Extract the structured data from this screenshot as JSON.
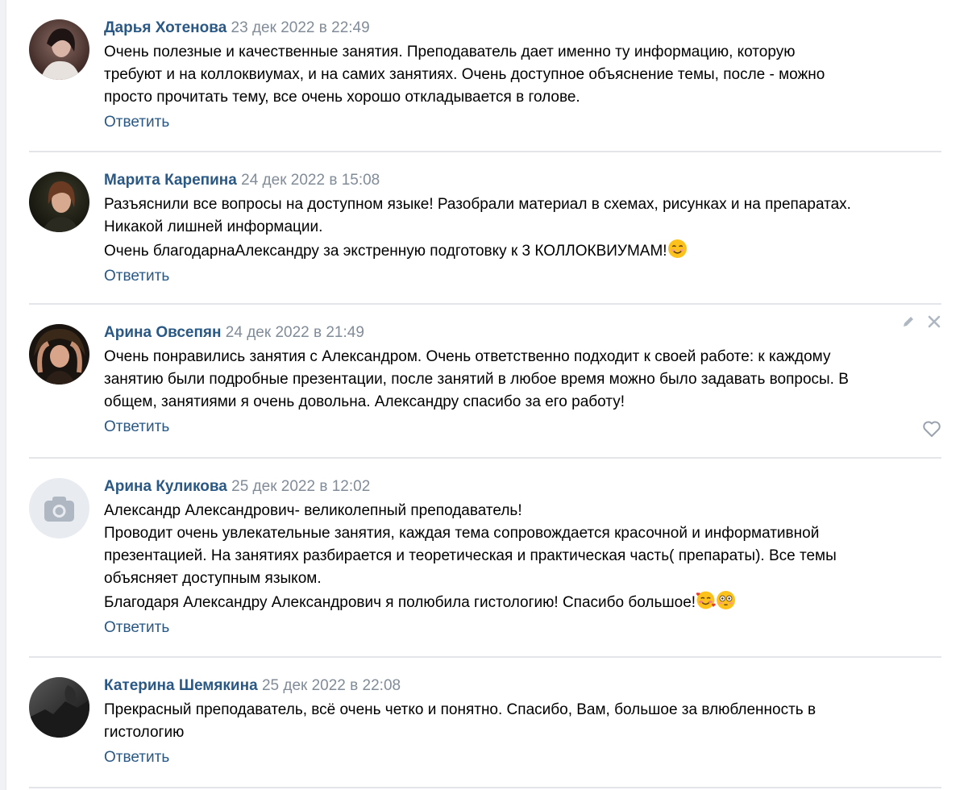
{
  "comments": [
    {
      "author": "Дарья Хотенова",
      "date": "23 дек 2022 в 22:49",
      "lines": [
        "Очень полезные и качественные занятия. Преподаватель дает именно ту информацию, которую",
        "требуют и на коллоквиумах, и на самих занятиях. Очень доступное объяснение темы, после - можно",
        "просто прочитать тему, все очень хорошо откладывается в голове."
      ],
      "reply": "Ответить"
    },
    {
      "author": "Марита Карепина",
      "date": "24 дек 2022 в 15:08",
      "lines": [
        "Разъяснили все вопросы на доступном языке! Разобрали материал в схемах, рисунках и на препаратах.",
        "Никакой лишней информации.",
        "Очень благодарнаАлександру за экстренную подготовку к 3 КОЛЛОКВИУМАМ!"
      ],
      "emojis": [
        "smiling-face-emoji"
      ],
      "reply": "Ответить"
    },
    {
      "author": "Арина Овсепян",
      "date": "24 дек 2022 в 21:49",
      "lines": [
        "Очень понравились занятия с Александром. Очень ответственно подходит к своей работе: к каждому",
        "занятию были подробные презентации, после занятий в любое время можно было задавать вопросы. В",
        "общем, занятиями я очень довольна. Александру спасибо за его работу!"
      ],
      "reply": "Ответить",
      "icons": [
        "pencil-icon",
        "close-icon",
        "heart-icon"
      ]
    },
    {
      "author": "Арина Куликова",
      "date": "25 дек 2022 в 12:02",
      "lines": [
        "Александр Александрович- великолепный преподаватель!",
        "Проводит очень увлекательные занятия, каждая тема сопровождается красочной и информативной",
        "презентацией. На занятиях разбирается и теоретическая и практическая часть( препараты). Все темы",
        "объясняет доступным языком.",
        "Благодаря Александру Александрович я полюбила гистологию! Спасибо большое!"
      ],
      "emojis": [
        "smiling-face-with-hearts-emoji",
        "flushed-face-emoji"
      ],
      "reply": "Ответить",
      "avatar_icon": "camera-icon"
    },
    {
      "author": "Катерина Шемякина",
      "date": "25 дек 2022 в 22:08",
      "lines": [
        "Прекрасный преподаватель, всё очень четко и понятно. Спасибо, Вам, большое за влюбленность в",
        "гистологию"
      ],
      "reply": "Ответить"
    }
  ],
  "colors": {
    "link": "#2a5885",
    "date": "#818c99",
    "divider": "#e3e5e9",
    "icon": "#aeb7c2"
  }
}
